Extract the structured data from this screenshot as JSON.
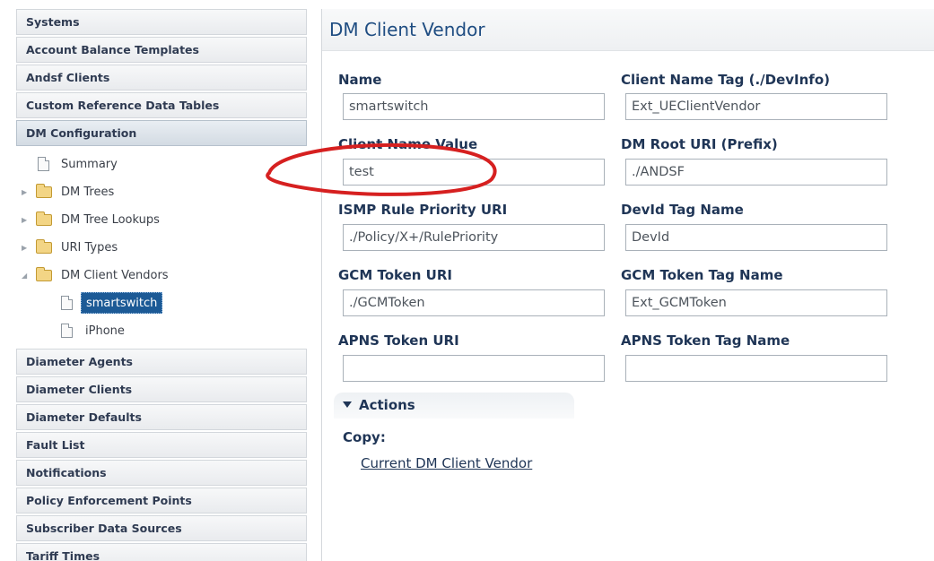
{
  "sidebar": {
    "sections_top": [
      "Systems",
      "Account Balance Templates",
      "Andsf Clients",
      "Custom Reference Data Tables"
    ],
    "active_section": "DM Configuration",
    "tree": {
      "summary": "Summary",
      "dm_trees": "DM Trees",
      "dm_tree_lookups": "DM Tree Lookups",
      "uri_types": "URI Types",
      "dm_client_vendors": "DM Client Vendors",
      "vendor_selected": "smartswitch",
      "vendor_other": "iPhone"
    },
    "sections_bottom": [
      "Diameter Agents",
      "Diameter Clients",
      "Diameter Defaults",
      "Fault List",
      "Notifications",
      "Policy Enforcement Points",
      "Subscriber Data Sources",
      "Tariff Times"
    ]
  },
  "main": {
    "title": "DM Client Vendor",
    "fields": {
      "name": {
        "label": "Name",
        "value": "smartswitch"
      },
      "client_name_tag": {
        "label": "Client Name Tag (./DevInfo)",
        "value": "Ext_UEClientVendor"
      },
      "client_name_value": {
        "label": "Client Name Value",
        "value": "test"
      },
      "dm_root_uri": {
        "label": "DM Root URI (Prefix)",
        "value": "./ANDSF"
      },
      "ismp_rule_priority_uri": {
        "label": "ISMP Rule Priority URI",
        "value": "./Policy/X+/RulePriority"
      },
      "devid_tag_name": {
        "label": "DevId Tag Name",
        "value": "DevId"
      },
      "gcm_token_uri": {
        "label": "GCM Token URI",
        "value": "./GCMToken"
      },
      "gcm_token_tag_name": {
        "label": "GCM Token Tag Name",
        "value": "Ext_GCMToken"
      },
      "apns_token_uri": {
        "label": "APNS Token URI",
        "value": ""
      },
      "apns_token_tag_name": {
        "label": "APNS Token Tag Name",
        "value": ""
      }
    },
    "actions": {
      "label": "Actions",
      "copy_label": "Copy:",
      "copy_link": "Current DM Client Vendor"
    }
  },
  "annotation": {
    "color": "#d62020"
  }
}
